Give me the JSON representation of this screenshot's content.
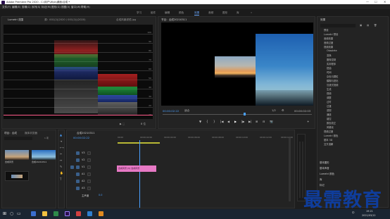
{
  "window": {
    "title": "Adobe Premiere Pro 2020 - C:\\用户\\Wyb\\桌面\\合成 *",
    "min": "—",
    "max": "☐",
    "close": "✕"
  },
  "menu": [
    "文件(F)",
    "编辑(E)",
    "剪辑(C)",
    "序列(S)",
    "标记(M)",
    "图形(G)",
    "视图(V)",
    "窗口(W)",
    "帮助(H)"
  ],
  "workspaces": [
    "学习",
    "组件",
    "编辑",
    "颜色",
    "效果",
    "音频",
    "图形",
    "库"
  ],
  "workspace_active_index": 4,
  "scopes": {
    "tab": "Lumetri 范围",
    "source_label": "源：001(2)(2020 / 001(2))(2020)",
    "clip_label": "合成风景滤镜.jpg",
    "values": [
      "100",
      "90",
      "80",
      "70",
      "60",
      "50",
      "40",
      "30",
      "20",
      "10"
    ],
    "footer_left": "8 位",
    "footer_icons": "▶ ⬚"
  },
  "program": {
    "tab": "节目：合成20210311",
    "timecode_left": "00:00:02:22",
    "fit": "适合",
    "quality": "1/2",
    "timecode_right": "00:00:02:03"
  },
  "transport": [
    "▼",
    "{",
    "}",
    "|◀",
    "◀|",
    "◀",
    "▶",
    "|▶",
    "▶|",
    "⊞",
    "⊟",
    "📷",
    "+"
  ],
  "project": {
    "tabs": [
      "项目：合成",
      "媒体浏览器"
    ],
    "items_count": "1 项",
    "search_placeholder": "",
    "item1": "合成风景",
    "item2": "合成20210311"
  },
  "timeline": {
    "tab": "合成20210311",
    "timecode": "00:00:02:22",
    "ruler": [
      "00:00",
      "00:00:02:00",
      "00:00:04:00",
      "00:00:06:00",
      "00:00:08:00",
      "00:00:10:00",
      "00:00:12:00",
      "00:00:14:00"
    ],
    "tracks": [
      {
        "id": "V3",
        "label": "V3"
      },
      {
        "id": "V2",
        "label": "V2"
      },
      {
        "id": "V1",
        "label": "V1"
      },
      {
        "id": "A1",
        "label": "A1"
      },
      {
        "id": "A2",
        "label": "A2"
      },
      {
        "id": "A3",
        "label": "A3"
      }
    ],
    "master": "主声道",
    "master_value": "0.0",
    "clip_label": "合成风景 [V] 合成风景"
  },
  "effects": {
    "tab": "效果",
    "search_placeholder": "",
    "tree": [
      "预设",
      "Lumetri 预设",
      "音频效果",
      "音频过渡",
      "视频效果",
      "Obsolete",
      "变换",
      "图像控制",
      "实用程序",
      "扭曲",
      "时间",
      "杂色与颗粒",
      "模糊与锐化",
      "沉浸式视频",
      "生成",
      "视频",
      "调整",
      "过时",
      "过渡",
      "透视",
      "通道",
      "键控",
      "颜色校正",
      "风格化",
      "视频过渡",
      "Lumetri 颜色",
      "基本 3D",
      "交叉溶解"
    ],
    "bottom": [
      "基本图形",
      "基本声音",
      "Lumetri 颜色",
      "库",
      "标记"
    ]
  },
  "taskbar": {
    "time": "19:21",
    "date": "2021/03/12",
    "lang": "中"
  },
  "watermark": "最需教育",
  "colors": {
    "accent": "#4aa0ff",
    "clip": "#e779c5",
    "panel": "#232323",
    "watermark": "#0f3d9c"
  }
}
